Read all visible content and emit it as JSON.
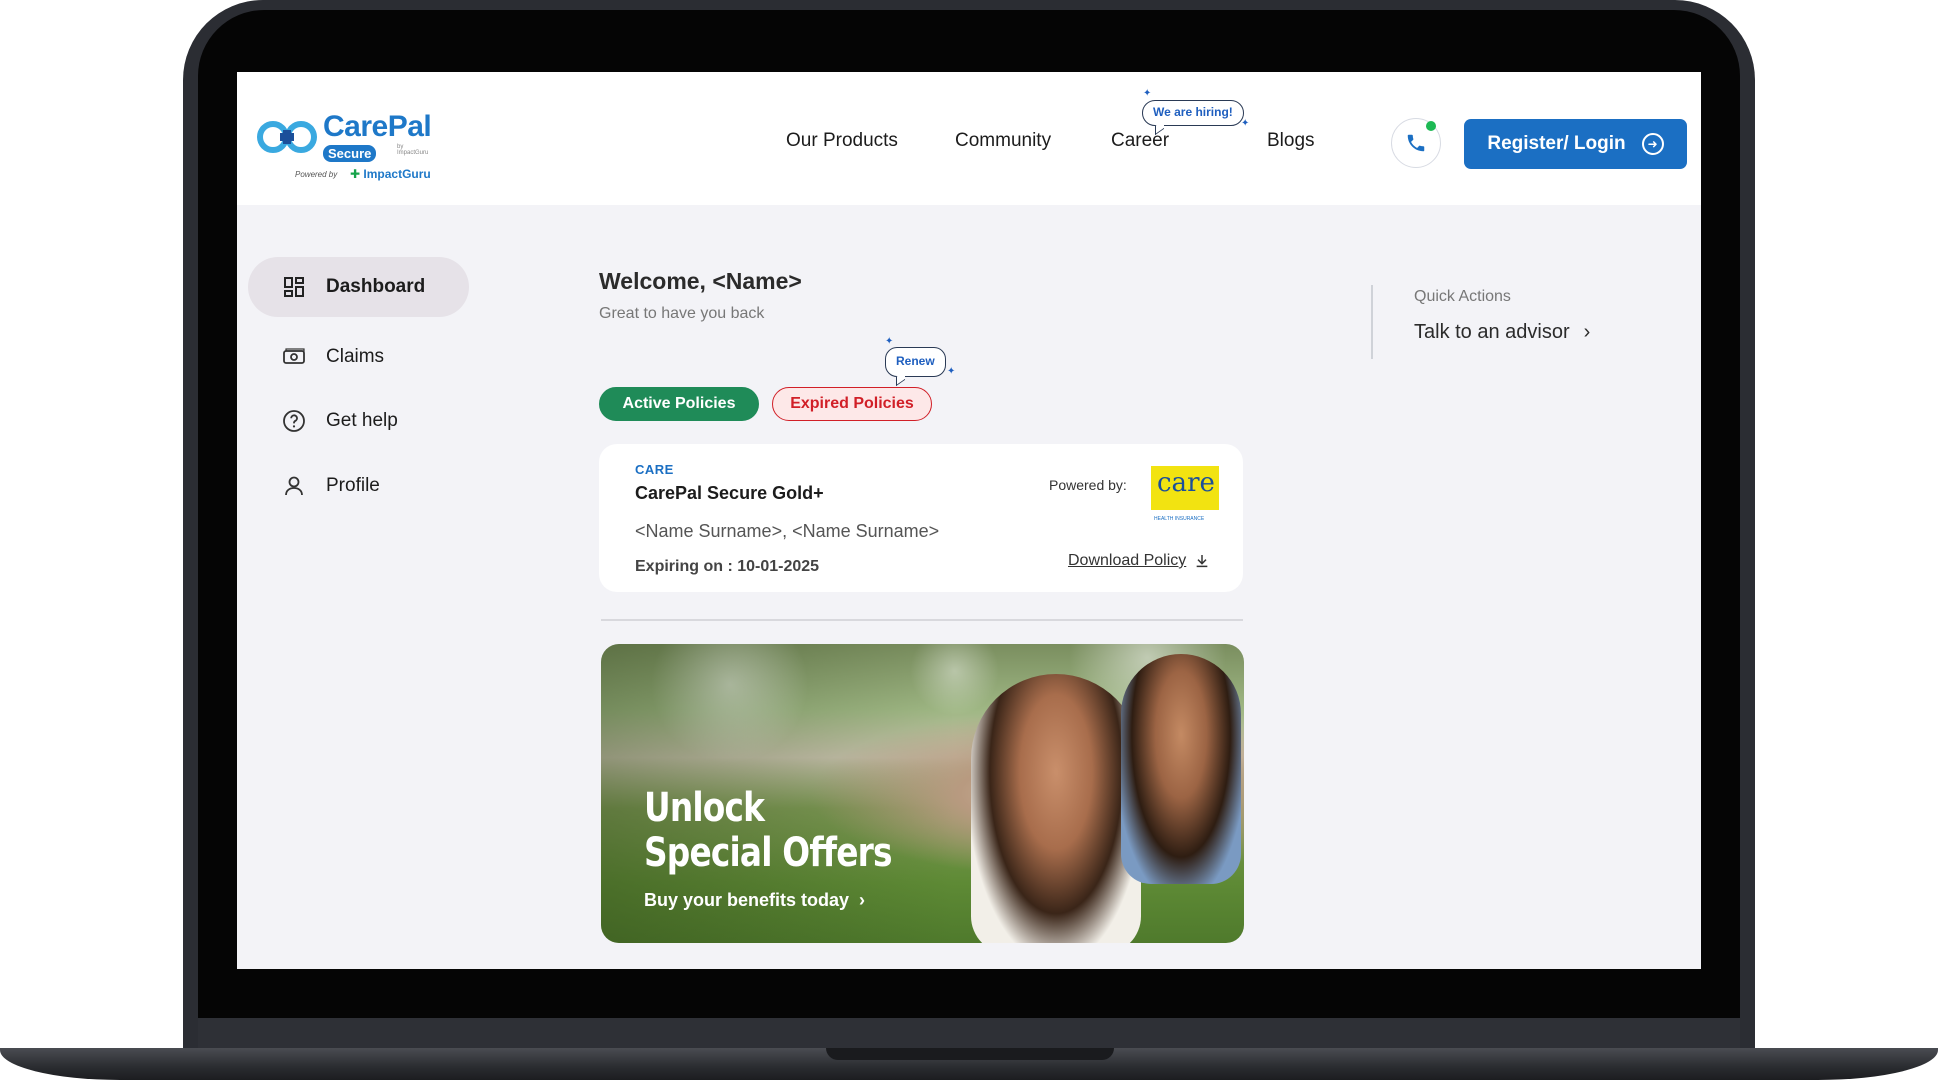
{
  "header": {
    "brand": "CarePal",
    "brand_badge": "Secure",
    "brand_byline": "by ImpactGuru",
    "powered_by": "Powered by",
    "powered_brand": "ImpactGuru",
    "nav": [
      {
        "label": "Our Products"
      },
      {
        "label": "Community"
      },
      {
        "label": "Career"
      },
      {
        "label": "Blogs"
      }
    ],
    "hiring_badge": "We are hiring!",
    "login_label": "Register/ Login"
  },
  "sidebar": {
    "items": [
      {
        "label": "Dashboard",
        "icon": "dashboard-icon",
        "active": true
      },
      {
        "label": "Claims",
        "icon": "cash-icon"
      },
      {
        "label": "Get help",
        "icon": "help-circle-icon"
      },
      {
        "label": "Profile",
        "icon": "user-icon"
      }
    ]
  },
  "main": {
    "welcome": "Welcome, <Name>",
    "subtitle": "Great to have you back",
    "renew_badge": "Renew",
    "tabs": [
      {
        "label": "Active Policies",
        "active": true
      },
      {
        "label": "Expired Policies"
      }
    ],
    "policy": {
      "insurer": "CARE",
      "plan": "CarePal Secure Gold+",
      "members": "<Name Surname>, <Name Surname>",
      "expiry": "Expiring on : 10-01-2025",
      "powered_by": "Powered by:",
      "insurer_logo": "care",
      "insurer_logo_sub": "HEALTH INSURANCE",
      "download": "Download Policy"
    },
    "banner": {
      "line1": "Unlock",
      "line2": "Special Offers",
      "cta": "Buy your benefits today"
    }
  },
  "quick_actions": {
    "title": "Quick Actions",
    "link": "Talk to an advisor"
  },
  "colors": {
    "primary": "#1b6fc3",
    "active_green": "#1f8b58",
    "expired_red": "#d11f27",
    "background": "#f3f3f7"
  }
}
